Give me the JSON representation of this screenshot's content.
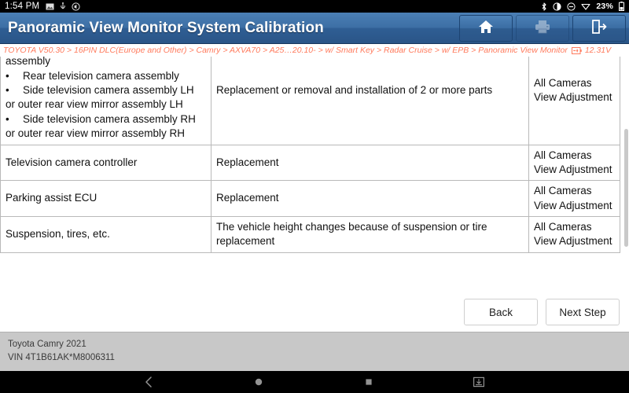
{
  "statusbar": {
    "clock": "1:54 PM",
    "left_icons": [
      "image-icon",
      "usb-icon",
      "no-sound-icon"
    ],
    "right_icons": [
      "bluetooth-icon",
      "brightness-icon",
      "do-not-disturb-icon",
      "wifi-icon"
    ],
    "battery_percent": "23%",
    "battery_icon": "battery-icon"
  },
  "titlebar": {
    "title": "Panoramic View Monitor System Calibration",
    "buttons": [
      {
        "name": "home-button",
        "icon": "home-icon"
      },
      {
        "name": "print-button",
        "icon": "printer-icon"
      },
      {
        "name": "exit-button",
        "icon": "exit-icon"
      }
    ]
  },
  "breadcrumb": {
    "path": "TOYOTA V50.30 > 16PIN DLC(Europe and Other) > Camry > AXVA70 > A25…20.10- > w/ Smart Key > Radar Cruise > w/ EPB > Panoramic View Monitor",
    "battery_icon": "battery-icon",
    "voltage": "12.31V"
  },
  "table": {
    "rows": [
      {
        "part_intro": "radiator grille assembly or front bumper assembly",
        "bullets": [
          "Rear television camera assembly",
          "Side television camera assembly LH",
          "Side television camera assembly RH"
        ],
        "bullet_continuations": [
          "or outer rear view mirror assembly LH",
          "or outer rear view mirror assembly RH"
        ],
        "condition": "Replacement or removal and installation of 2 or more parts",
        "procedure": "All Cameras View Adjustment"
      },
      {
        "part": "Television camera controller",
        "condition": "Replacement",
        "procedure": "All Cameras View Adjustment"
      },
      {
        "part": "Parking assist ECU",
        "condition": "Replacement",
        "procedure": "All Cameras View Adjustment"
      },
      {
        "part": "Suspension, tires, etc.",
        "condition": "The vehicle height changes because of suspension or tire replacement",
        "procedure": "All Cameras View Adjustment"
      }
    ]
  },
  "actions": {
    "back_label": "Back",
    "next_label": "Next Step"
  },
  "footer": {
    "vehicle": "Toyota Camry 2021",
    "vin": "VIN 4T1B61AK*M8006311"
  },
  "navbar": {
    "items": [
      "back-nav-icon",
      "home-nav-icon",
      "recents-nav-icon",
      "screenshot-nav-icon"
    ]
  },
  "colors": {
    "header_blue": "#3d6fa5",
    "breadcrumb_orange": "#ff7a5c",
    "footer_gray": "#c8c8c8"
  }
}
